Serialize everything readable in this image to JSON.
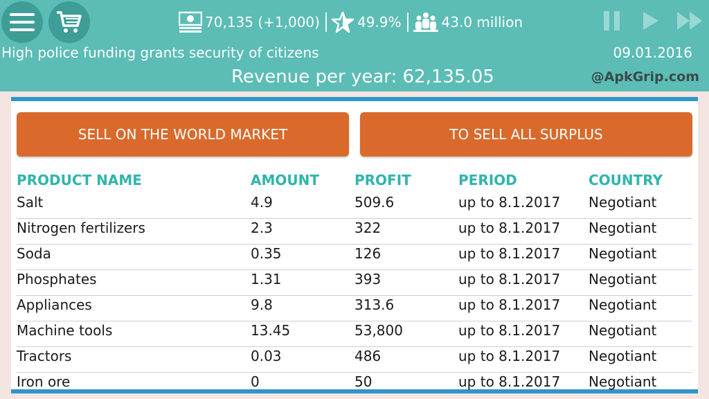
{
  "top": {
    "money": "70,135 (+1,000)",
    "rating": "49.9%",
    "population": "43.0 million",
    "headline": "High police funding grants security of citizens",
    "date": "09.01.2016",
    "revenue": "Revenue per year: 62,135.05",
    "watermark": "@ApkGrip.com"
  },
  "buttons": {
    "sell_world": "SELL ON THE WORLD MARKET",
    "sell_surplus": "TO SELL ALL SURPLUS"
  },
  "table": {
    "headers": [
      "PRODUCT NAME",
      "AMOUNT",
      "PROFIT",
      "PERIOD",
      "COUNTRY"
    ],
    "rows": [
      [
        "Salt",
        "4.9",
        "509.6",
        "up to 8.1.2017",
        "Negotiant"
      ],
      [
        "Nitrogen fertilizers",
        "2.3",
        "322",
        "up to 8.1.2017",
        "Negotiant"
      ],
      [
        "Soda",
        "0.35",
        "126",
        "up to 8.1.2017",
        "Negotiant"
      ],
      [
        "Phosphates",
        "1.31",
        "393",
        "up to 8.1.2017",
        "Negotiant"
      ],
      [
        "Appliances",
        "9.8",
        "313.6",
        "up to 8.1.2017",
        "Negotiant"
      ],
      [
        "Machine tools",
        "13.45",
        "53,800",
        "up to 8.1.2017",
        "Negotiant"
      ],
      [
        "Tractors",
        "0.03",
        "486",
        "up to 8.1.2017",
        "Negotiant"
      ],
      [
        "Iron ore",
        "0",
        "50",
        "up to 8.1.2017",
        "Negotiant"
      ]
    ]
  },
  "icons": [
    "menu-icon",
    "cart-icon",
    "money-icon",
    "star-icon",
    "population-icon",
    "pause-icon",
    "play-icon",
    "fast-forward-icon"
  ]
}
